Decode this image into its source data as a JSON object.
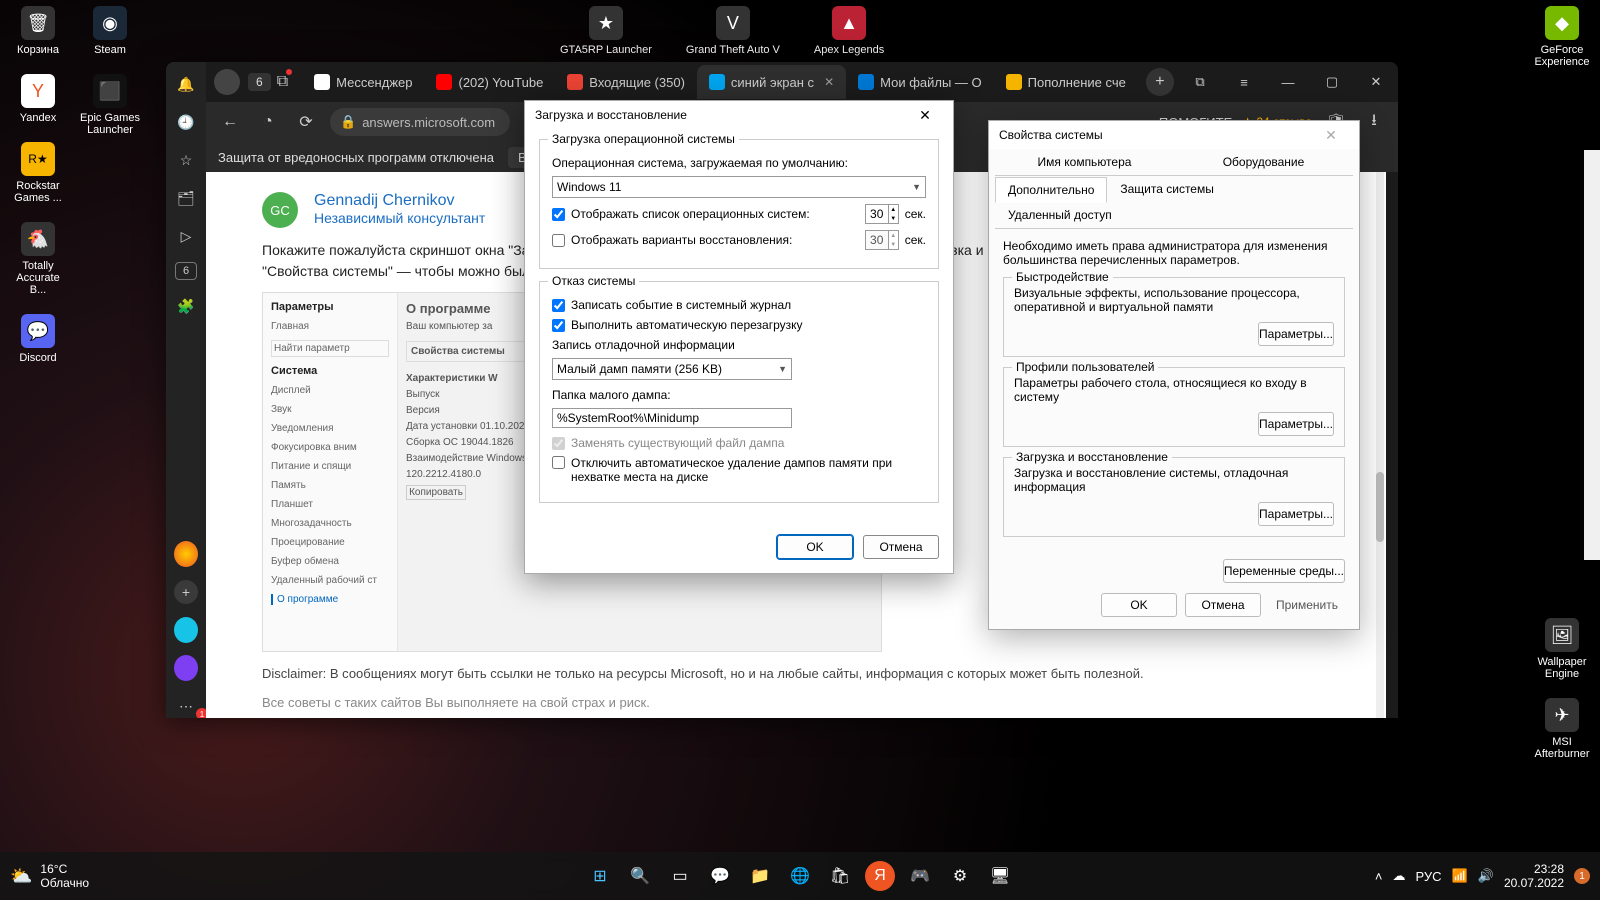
{
  "desktop": {
    "left_col1": [
      {
        "label": "Корзина",
        "glyph": "🗑"
      },
      {
        "label": "Yandex",
        "glyph": "Y"
      },
      {
        "label": "Rockstar Games ...",
        "glyph": "R★"
      },
      {
        "label": "Totally Accurate B...",
        "glyph": "🐔"
      },
      {
        "label": "Discord",
        "glyph": "💬"
      }
    ],
    "left_col2": [
      {
        "label": "Steam",
        "glyph": "◉"
      },
      {
        "label": "Epic Games Launcher",
        "glyph": "⬛"
      }
    ],
    "top_row": [
      {
        "label": "GTA5RP Launcher",
        "glyph": "★"
      },
      {
        "label": "Grand Theft Auto V",
        "glyph": "V"
      },
      {
        "label": "Apex Legends",
        "glyph": "▲"
      }
    ],
    "right_col": [
      {
        "label": "GeForce Experience",
        "glyph": "◆"
      }
    ],
    "right_bottom": [
      {
        "label": "Wallpaper Engine",
        "glyph": "🖼"
      },
      {
        "label": "MSI Afterburner",
        "glyph": "✈"
      }
    ]
  },
  "browser": {
    "win_count": "6",
    "tabs": [
      {
        "label": "Мессенджер",
        "ic_bg": "#fff",
        "glyph": "💬"
      },
      {
        "label": "(202) YouTube",
        "ic_bg": "#f00",
        "glyph": "▶"
      },
      {
        "label": "Входящие (350)",
        "ic_bg": "#ea4335",
        "glyph": "M"
      },
      {
        "label": "синий экран с",
        "ic_bg": "#00a4ef",
        "glyph": "⊞",
        "active": true
      },
      {
        "label": "Мои файлы — О",
        "ic_bg": "#0078d4",
        "glyph": "☁"
      },
      {
        "label": "Пополнение сче",
        "ic_bg": "#f5b400",
        "glyph": "★"
      }
    ],
    "notif_badge": "1",
    "address": "answers.microsoft.com",
    "help_label": "ПОМОГИТЕ",
    "reviews": "★ 24 отзыва",
    "infobar": {
      "msg": "Защита от вредоносных программ отключена",
      "action": "Включ"
    },
    "page": {
      "avatar_initials": "GC",
      "author": "Gennadij Chernikov",
      "role": "Независимый консультант",
      "body": "Покажите пожалуйста скриншот окна \"Загрузка и восстановление\", которое открывается из группы \"Загрузка и восстановление\" на вкладке \"Дополнительно\" в \"Свойства системы\" — чтобы можно было проверить, нет ли ошибок в сделанных Вами настройках.",
      "shot_heading": "О программе",
      "shot_sub": "Ваш компьютер за",
      "shot_side_title": "Параметры",
      "shot_side_main": "Главная",
      "shot_side_find": "Найти параметр",
      "shot_side_section": "Система",
      "shot_side_items": [
        "Дисплей",
        "Звук",
        "Уведомления",
        "Фокусировка вним",
        "Питание и спящи",
        "Память",
        "Планшет",
        "Многозадачность",
        "Проецирование",
        "Буфер обмена",
        "Удаленный рабочий ст",
        "О программе"
      ],
      "shot_sys_title": "Свойства системы",
      "shot_spec_title": "Характеристики W",
      "shot_spec_rows": [
        "Выпуск",
        "Версия",
        "Дата установки      01.10.2020",
        "Сборка ОС           19044.1826",
        "Взаимодействие   Windows Feature Experience Pack",
        "                         120.2212.4180.0"
      ],
      "shot_copy": "Копировать",
      "disclaimer": "Disclaimer: В сообщениях могут быть ссылки не только на ресурсы Microsoft, но и на любые сайты, информация с которых может быть полезной.",
      "disclaimer2": "Все советы с таких сайтов Вы выполняете на свой страх и риск."
    }
  },
  "dlg1": {
    "title": "Загрузка и восстановление",
    "g1_title": "Загрузка операционной системы",
    "os_default_label": "Операционная система, загружаемая по умолчанию:",
    "os_default_value": "Windows 11",
    "show_list_label": "Отображать список операционных систем:",
    "show_list_checked": true,
    "show_list_secs": "30",
    "show_recovery_label": "Отображать варианты восстановления:",
    "show_recovery_checked": false,
    "show_recovery_secs": "30",
    "sec": "сек.",
    "g2_title": "Отказ системы",
    "log_event_label": "Записать событие в системный журнал",
    "log_event_checked": true,
    "auto_restart_label": "Выполнить автоматическую перезагрузку",
    "auto_restart_checked": true,
    "debug_info_label": "Запись отладочной информации",
    "debug_info_value": "Малый дамп памяти (256 KB)",
    "dump_folder_label": "Папка малого дампа:",
    "dump_folder_value": "%SystemRoot%\\Minidump",
    "overwrite_label": "Заменять существующий файл дампа",
    "overwrite_checked": true,
    "disable_autodel_label": "Отключить автоматическое удаление дампов памяти при нехватке места на диске",
    "disable_autodel_checked": false,
    "ok": "OK",
    "cancel": "Отмена"
  },
  "dlg2": {
    "title": "Свойства системы",
    "tabs_row1": [
      "Имя компьютера",
      "Оборудование"
    ],
    "tabs_row2": [
      "Дополнительно",
      "Защита системы",
      "Удаленный доступ"
    ],
    "active_tab": "Дополнительно",
    "admin_note": "Необходимо иметь права администратора для изменения большинства перечисленных параметров.",
    "g_perf": {
      "title": "Быстродействие",
      "desc": "Визуальные эффекты, использование процессора, оперативной и виртуальной памяти"
    },
    "g_prof": {
      "title": "Профили пользователей",
      "desc": "Параметры рабочего стола, относящиеся ко входу в систему"
    },
    "g_boot": {
      "title": "Загрузка и восстановление",
      "desc": "Загрузка и восстановление системы, отладочная информация"
    },
    "params_btn": "Параметры...",
    "env_btn": "Переменные среды...",
    "ok": "OK",
    "cancel": "Отмена",
    "apply": "Применить"
  },
  "taskbar": {
    "weather": {
      "temp": "16°C",
      "cond": "Облачно"
    },
    "center": [
      "⊞",
      "🔍",
      "▭",
      "💬",
      "📁",
      "🌐",
      "🛍",
      "Я",
      "🎮",
      "⚙",
      "🖥"
    ],
    "tray": {
      "lang": "РУС",
      "time": "23:28",
      "date": "20.07.2022",
      "notif": "1"
    }
  }
}
